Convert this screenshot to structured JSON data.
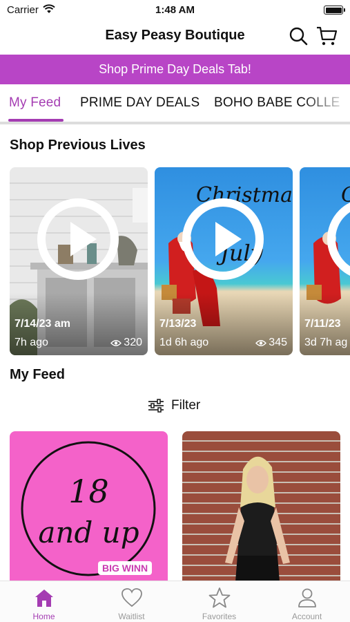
{
  "status_bar": {
    "carrier": "Carrier",
    "time": "1:48 AM"
  },
  "header": {
    "title": "Easy Peasy Boutique"
  },
  "promo": {
    "text": "Shop Prime Day Deals Tab!"
  },
  "tabs": [
    {
      "label": "My Feed",
      "active": true
    },
    {
      "label": "PRIME DAY DEALS",
      "active": false
    },
    {
      "label": "BOHO BABE COLLE",
      "active": false
    }
  ],
  "previous_lives": {
    "title": "Shop Previous Lives",
    "items": [
      {
        "date": "7/14/23 am",
        "ago": "7h ago",
        "views": "320"
      },
      {
        "date": "7/13/23",
        "ago": "1d 6h ago",
        "views": "345"
      },
      {
        "date": "7/11/23",
        "ago": "3d 7h ag",
        "views": ""
      }
    ]
  },
  "feed": {
    "title": "My Feed",
    "filter_label": "Filter",
    "cards": [
      {
        "line1": "18",
        "line2": "and up",
        "badge": "BIG WINN"
      },
      {
        "line1": "",
        "line2": "",
        "badge": ""
      }
    ]
  },
  "bottom_nav": [
    {
      "label": "Home",
      "icon": "home-icon",
      "active": true
    },
    {
      "label": "Waitlist",
      "icon": "heart-icon",
      "active": false
    },
    {
      "label": "Favorites",
      "icon": "star-icon",
      "active": false
    },
    {
      "label": "Account",
      "icon": "person-icon",
      "active": false
    }
  ],
  "colors": {
    "accent": "#a43cb2",
    "promo_bg": "#b845c6",
    "pink_card": "#f462c9"
  }
}
